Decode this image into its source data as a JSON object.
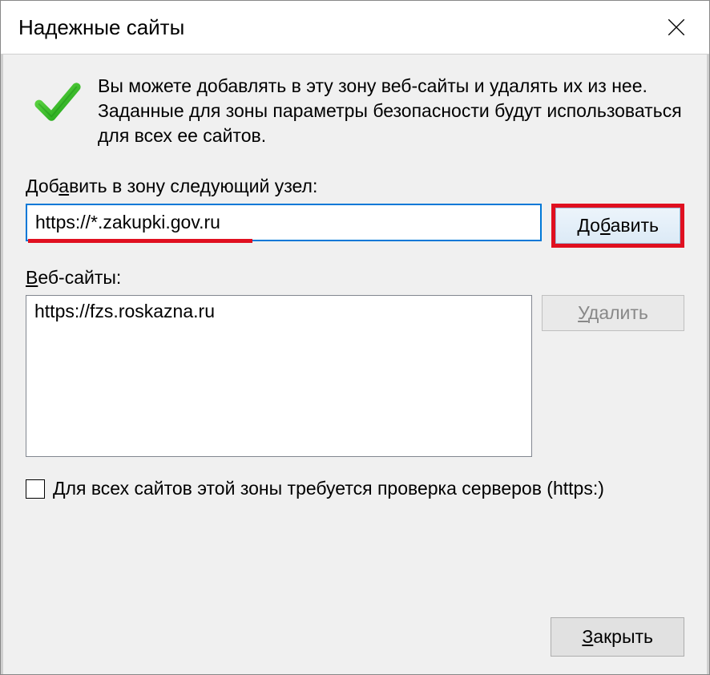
{
  "dialog": {
    "title": "Надежные сайты",
    "intro_text": "Вы можете добавлять в эту зону  веб-сайты и удалять их из нее. Заданные для зоны параметры безопасности будут использоваться для всех ее сайтов.",
    "add_label": "Добавить в зону следующий узел:",
    "input_value": "https://*.zakupki.gov.ru",
    "add_button": "Добавить",
    "websites_label": "Веб-сайты:",
    "websites": [
      "https://fzs.roskazna.ru"
    ],
    "delete_button": "Удалить",
    "checkbox_label": "Для всех сайтов этой зоны требуется проверка серверов (https:)",
    "checkbox_checked": false,
    "close_button": "Закрыть"
  }
}
